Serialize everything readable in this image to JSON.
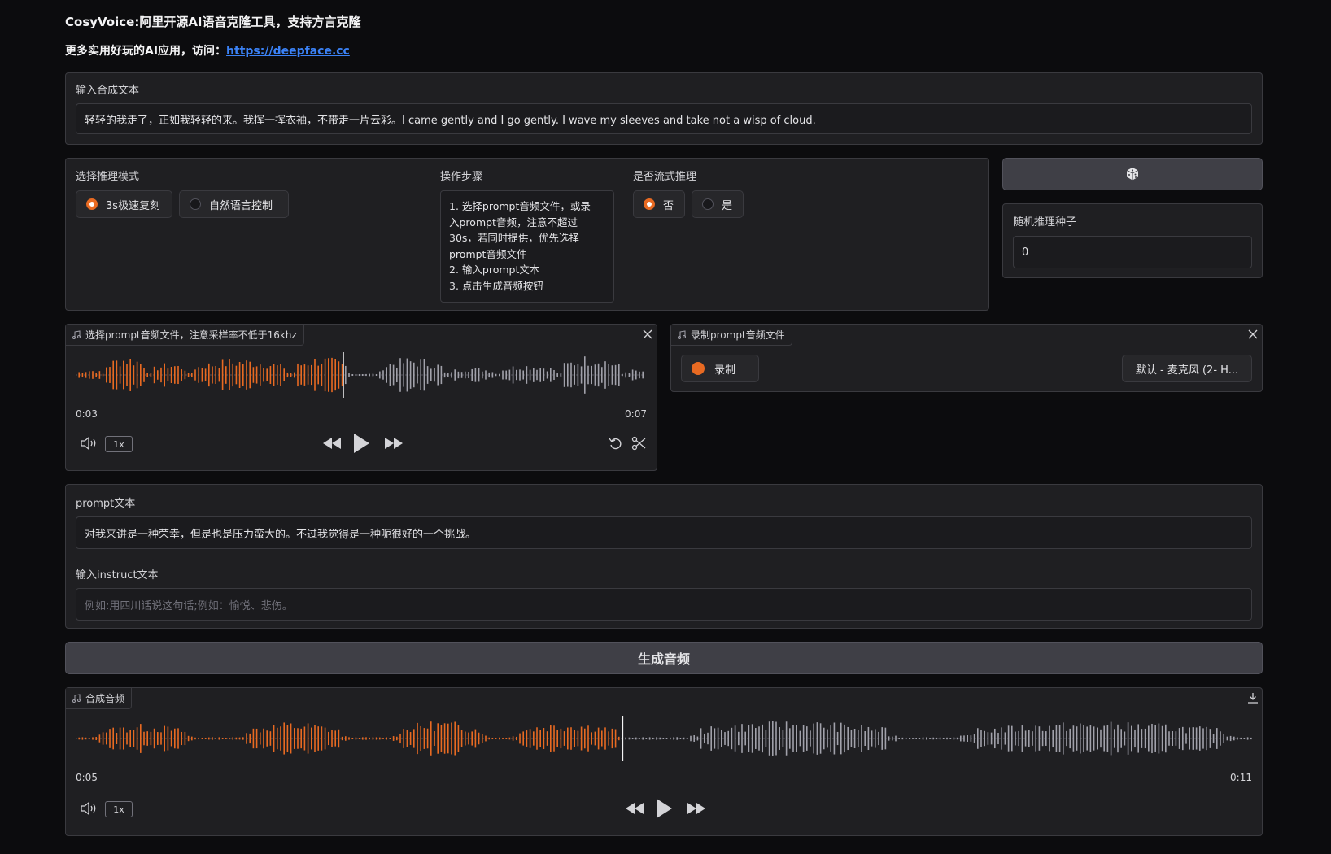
{
  "header": {
    "title": "CosyVoice:阿里开源AI语音克隆工具，支持方言克隆",
    "subtitle_prefix": "更多实用好玩的AI应用，访问：",
    "subtitle_link": "https://deepface.cc"
  },
  "tts_text": {
    "label": "输入合成文本",
    "value": "轻轻的我走了，正如我轻轻的来。我挥一挥衣袖，不带走一片云彩。I came gently and I go gently. I wave my sleeves and take not a wisp of cloud."
  },
  "mode": {
    "label": "选择推理模式",
    "options": [
      "3s极速复刻",
      "自然语言控制"
    ],
    "selected": 0
  },
  "steps": {
    "label": "操作步骤",
    "lines": [
      "1. 选择prompt音频文件，或录",
      "入prompt音频，注意不超过",
      "30s，若同时提供，优先选择",
      "prompt音频文件",
      "2. 输入prompt文本",
      "3. 点击生成音频按钮"
    ]
  },
  "stream": {
    "label": "是否流式推理",
    "options": [
      "否",
      "是"
    ],
    "selected": 0
  },
  "seed": {
    "label": "随机推理种子",
    "value": "0",
    "dice_icon": "dice-icon"
  },
  "prompt_audio": {
    "label": "选择prompt音频文件，注意采样率不低于16khz",
    "current_time": "0:03",
    "duration": "0:07",
    "speed": "1x",
    "progress": 0.47
  },
  "record": {
    "label": "录制prompt音频文件",
    "record_label": "录制",
    "device": "默认 - 麦克风 (2- H..."
  },
  "prompt_text": {
    "label": "prompt文本",
    "value": "对我来讲是一种荣幸，但是也是压力蛮大的。不过我觉得是一种呃很好的一个挑战。"
  },
  "instruct": {
    "label": "输入instruct文本",
    "placeholder": "例如:用四川话说这句话;例如：愉悦、悲伤。"
  },
  "generate": {
    "label": "生成音频"
  },
  "output_audio": {
    "label": "合成音频",
    "current_time": "0:05",
    "duration": "0:11",
    "speed": "1x",
    "progress": 0.465
  },
  "colors": {
    "accent": "#e86a22",
    "played": "#e86a22",
    "unplayed": "#a1a1aa"
  }
}
